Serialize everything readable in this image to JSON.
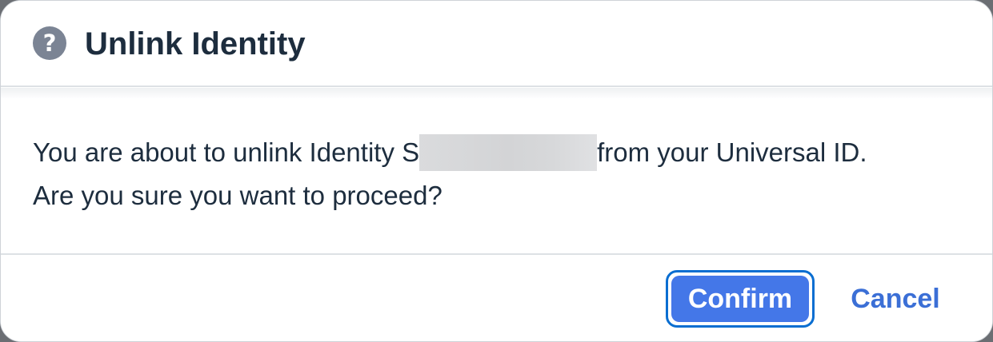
{
  "dialog": {
    "title": "Unlink Identity",
    "icon": "help-icon",
    "icon_glyph": "?",
    "message": {
      "line1_before": "You are about to unlink Identity S",
      "line1_after": "from your Universal ID.",
      "line2": "Are you sure you want to proceed?"
    },
    "buttons": {
      "confirm_label": "Confirm",
      "cancel_label": "Cancel"
    }
  },
  "colors": {
    "title_text": "#1d2d3e",
    "icon_bg": "#7b8494",
    "confirm_bg": "#4477e8",
    "focus_ring": "#0a6ed1",
    "cancel_text": "#3b6fd6"
  }
}
